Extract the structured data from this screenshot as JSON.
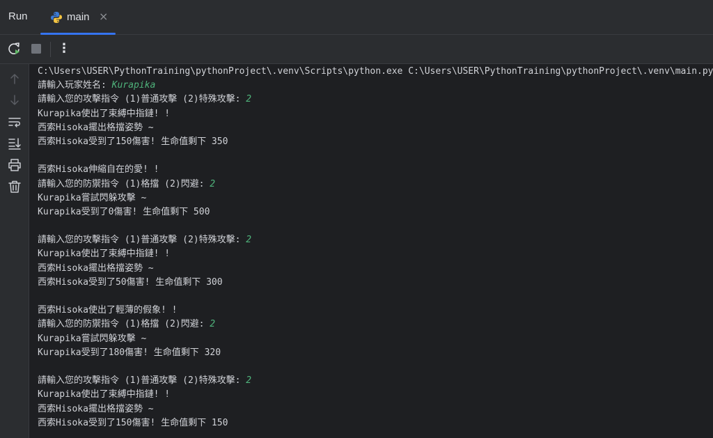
{
  "tabbar": {
    "run_label": "Run",
    "tab": {
      "label": "main",
      "icon": "python-icon",
      "close": "×"
    }
  },
  "toolbar": {
    "rerun_icon": "rerun-icon",
    "stop_icon": "stop-icon",
    "more_icon": "more-vertical-icon",
    "more_glyph": "⋮"
  },
  "sidebar": {
    "items": [
      "arrow-up-icon",
      "arrow-down-icon",
      "soft-wrap-icon",
      "scroll-to-end-icon",
      "print-icon",
      "trash-icon"
    ]
  },
  "colors": {
    "accent": "#3574f0",
    "input_text": "#4fb37b",
    "rerun_green": "#5fb865",
    "output_text": "#d1d3d8"
  },
  "console": {
    "lines": [
      {
        "text": "C:\\Users\\USER\\PythonTraining\\pythonProject\\.venv\\Scripts\\python.exe C:\\Users\\USER\\PythonTraining\\pythonProject\\.venv\\main.py",
        "input": ""
      },
      {
        "text": "請輸入玩家姓名: ",
        "input": "Kurapika"
      },
      {
        "text": "請輸入您的攻擊指令 (1)普通攻擊 (2)特殊攻擊: ",
        "input": "2"
      },
      {
        "text": "Kurapika使出了束縛中指鏈! !",
        "input": ""
      },
      {
        "text": "西索Hisoka擺出格擋姿勢 ~",
        "input": ""
      },
      {
        "text": "西索Hisoka受到了150傷害! 生命值剩下 350",
        "input": ""
      },
      {
        "text": "",
        "input": ""
      },
      {
        "text": "西索Hisoka伸縮自在的愛! !",
        "input": ""
      },
      {
        "text": "請輸入您的防禦指令 (1)格擋 (2)閃避: ",
        "input": "2"
      },
      {
        "text": "Kurapika嘗試閃躲攻擊 ~",
        "input": ""
      },
      {
        "text": "Kurapika受到了0傷害! 生命值剩下 500",
        "input": ""
      },
      {
        "text": "",
        "input": ""
      },
      {
        "text": "請輸入您的攻擊指令 (1)普通攻擊 (2)特殊攻擊: ",
        "input": "2"
      },
      {
        "text": "Kurapika使出了束縛中指鏈! !",
        "input": ""
      },
      {
        "text": "西索Hisoka擺出格擋姿勢 ~",
        "input": ""
      },
      {
        "text": "西索Hisoka受到了50傷害! 生命值剩下 300",
        "input": ""
      },
      {
        "text": "",
        "input": ""
      },
      {
        "text": "西索Hisoka使出了輕薄的假象! !",
        "input": ""
      },
      {
        "text": "請輸入您的防禦指令 (1)格擋 (2)閃避: ",
        "input": "2"
      },
      {
        "text": "Kurapika嘗試閃躲攻擊 ~",
        "input": ""
      },
      {
        "text": "Kurapika受到了180傷害! 生命值剩下 320",
        "input": ""
      },
      {
        "text": "",
        "input": ""
      },
      {
        "text": "請輸入您的攻擊指令 (1)普通攻擊 (2)特殊攻擊: ",
        "input": "2"
      },
      {
        "text": "Kurapika使出了束縛中指鏈! !",
        "input": ""
      },
      {
        "text": "西索Hisoka擺出格擋姿勢 ~",
        "input": ""
      },
      {
        "text": "西索Hisoka受到了150傷害! 生命值剩下 150",
        "input": ""
      }
    ]
  }
}
